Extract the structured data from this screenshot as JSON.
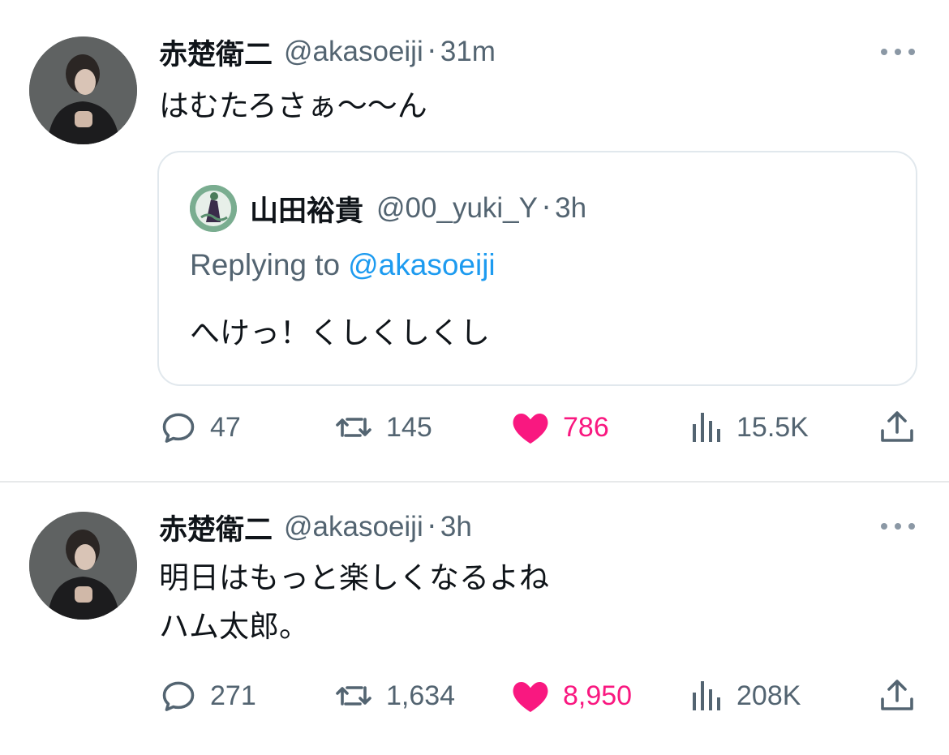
{
  "colors": {
    "text": "#0f1419",
    "secondary": "#536471",
    "link": "#1d9bf0",
    "like_active": "#f91880",
    "border": "#e1e8ed"
  },
  "tweets": [
    {
      "author_name": "赤楚衛二",
      "handle": "@akasoeiji",
      "separator": "·",
      "time": "31m",
      "text": "はむたろさぁ〜〜ん",
      "quoted": {
        "author_name": "山田裕貴",
        "handle": "@00_yuki_Y",
        "separator": "·",
        "time": "3h",
        "replying_prefix": "Replying to",
        "replying_handle": "@akasoeiji",
        "text": "へけっ！くしくしくし"
      },
      "stats": {
        "replies": "47",
        "retweets": "145",
        "likes": "786",
        "views": "15.5K",
        "liked": true
      }
    },
    {
      "author_name": "赤楚衛二",
      "handle": "@akasoeiji",
      "separator": "·",
      "time": "3h",
      "text_line1": "明日はもっと楽しくなるよね",
      "text_line2": "ハム太郎。",
      "stats": {
        "replies": "271",
        "retweets": "1,634",
        "likes": "8,950",
        "views": "208K",
        "liked": true
      }
    }
  ],
  "icons": {
    "more": "more-dots-icon",
    "reply": "reply-bubble-icon",
    "retweet": "retweet-icon",
    "like": "heart-filled-icon",
    "views": "views-bar-icon",
    "share": "share-upload-icon"
  }
}
